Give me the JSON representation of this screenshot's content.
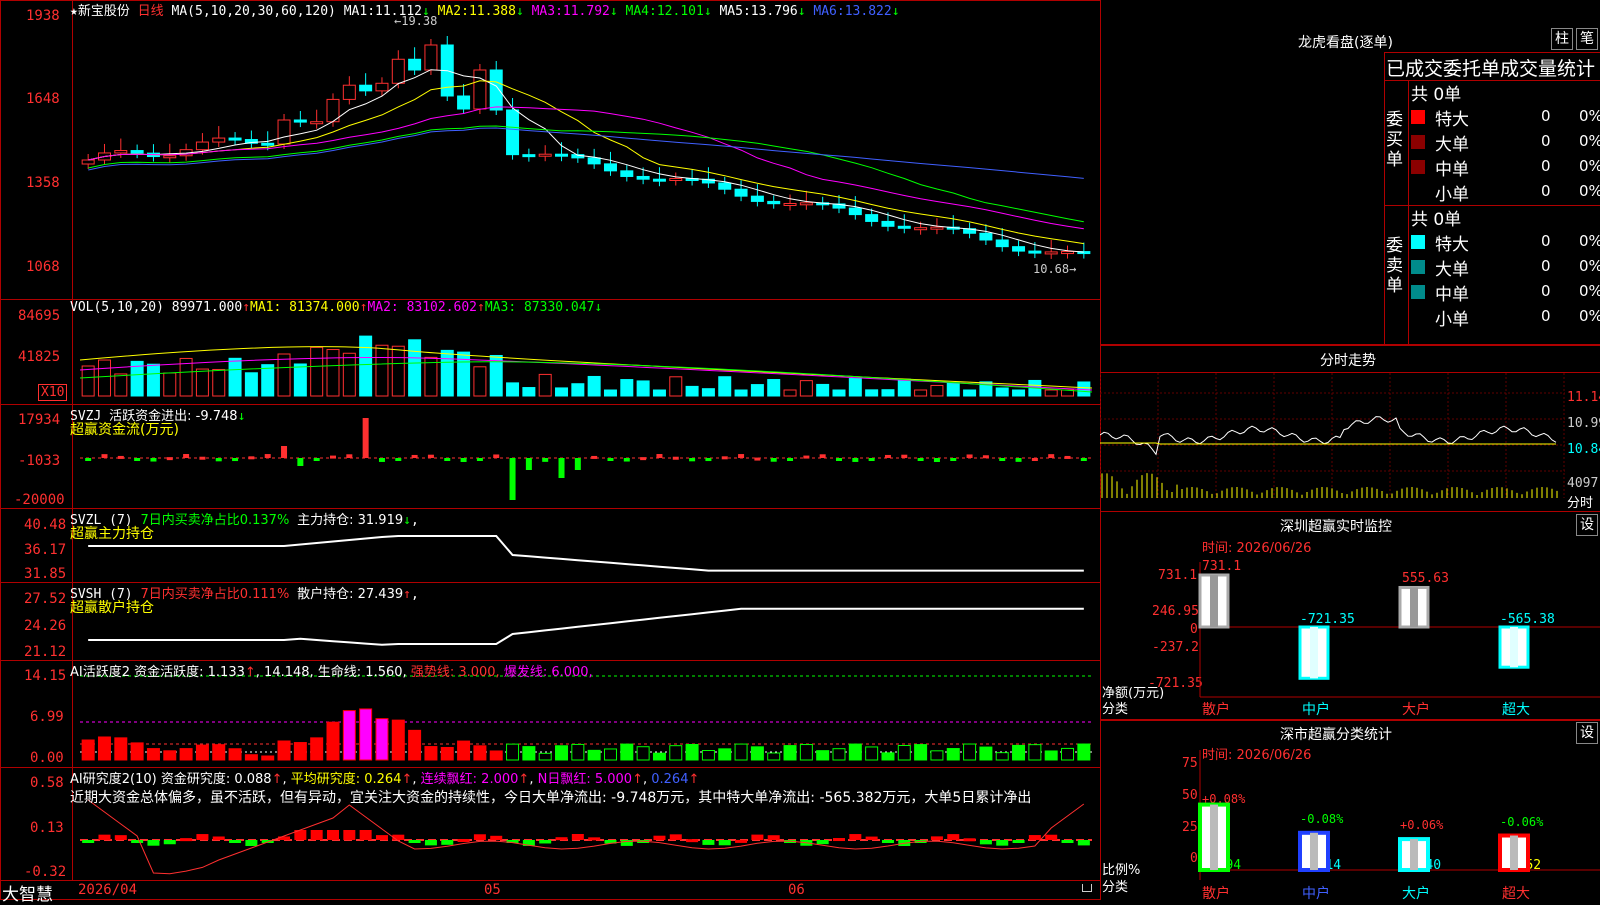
{
  "stock": {
    "star": "★",
    "name": "新宝股份",
    "period": "日线",
    "ma_label": "MA(5,10,20,30,60,120)",
    "ma": [
      {
        "name": "MA1:",
        "value": "11.112",
        "arrow": "↓"
      },
      {
        "name": "MA2:",
        "value": "11.388",
        "arrow": "↓"
      },
      {
        "name": "MA3:",
        "value": "11.792",
        "arrow": "↓"
      },
      {
        "name": "MA4:",
        "value": "12.101",
        "arrow": "↓"
      },
      {
        "name": "MA5:",
        "value": "13.796",
        "arrow": "↓"
      },
      {
        "name": "MA6:",
        "value": "13.822",
        "arrow": "↓"
      }
    ],
    "high_marker": "19.38",
    "low_marker": "10.68"
  },
  "price_axis": [
    "1938",
    "1648",
    "1358",
    "1068"
  ],
  "vol": {
    "label": "VOL(5,10,20)",
    "value": "89971.000",
    "arrow": "↑",
    "ma1": "MA1: 81374.000",
    "ma1_arrow": "↑",
    "ma2": "MA2: 83102.602",
    "ma2_arrow": "↑",
    "ma3": "MA3: 87330.047",
    "ma3_arrow": "↓",
    "axis": [
      "84695",
      "41825"
    ],
    "unit": "X10"
  },
  "svzj": {
    "label": "SVZJ",
    "text": "活跃资金进出: -9.748",
    "arrow": "↓",
    "subtitle": "超赢资金流(万元)",
    "axis": [
      "17934",
      "-1033",
      "-20000"
    ]
  },
  "svzl": {
    "label": "SVZL (7)",
    "ratio": "7日内买卖净占比0.137%",
    "hold": "主力持仓: 31.919",
    "arrow": "↓",
    "tail": ",",
    "subtitle": "超赢主力持仓",
    "axis": [
      "40.48",
      "36.17",
      "31.85"
    ]
  },
  "svsh": {
    "label": "SVSH (7)",
    "ratio": "7日内买卖净占比0.111%",
    "hold": "散户持仓: 27.439",
    "arrow": "↑",
    "tail": ",",
    "subtitle": "超赢散户持仓",
    "axis": [
      "27.52",
      "24.26",
      "21.12"
    ]
  },
  "ai_active": {
    "label": "AI活跃度2",
    "text1": "资金活跃度: 1.133",
    "arrow1": "↑",
    "text2": ", 14.148, 生命线: 1.560,",
    "strong": "强势线: 3.000,",
    "burst": "爆发线: 6.000,",
    "axis": [
      "14.15",
      "6.99",
      "0.00"
    ]
  },
  "ai_research": {
    "label": "AI研究度2(10)",
    "text1": "资金研究度: 0.088",
    "arrow1": "↑",
    "avg": "平均研究度: 0.264",
    "arrow2": "↑",
    "red_cnt": "连续飘红: 2.000",
    "arrow3": "↑",
    "n_red": "N日飘红: 5.000",
    "arrow4": "↑",
    "last": "0.264",
    "arrow5": "↑",
    "commentary": "近期大资金总体偏多，虽不活跃，但有异动，宜关注大资金的持续性，今日大单净流出: -9.748万元，其中特大单净流出: -565.382万元，大单5日累计净出",
    "axis": [
      "0.58",
      "0.13",
      "-0.32"
    ]
  },
  "bottom": {
    "brand": "大智慧",
    "date_start": "2026/04",
    "month1": "05",
    "month2": "06"
  },
  "lhb": {
    "title": "龙虎看盘(逐单)",
    "btn1": "柱",
    "btn2": "笔",
    "subtitle": "已成交委托单成交量统计",
    "buy_side": "委买单",
    "sell_side": "委卖单",
    "buy_total": "共 0单",
    "sell_total": "共 0单",
    "rows": [
      "特大",
      "大单",
      "中单",
      "小单"
    ],
    "count": "0",
    "pct": "0%",
    "colors_buy": [
      "#ff0000",
      "#8b0000",
      "#8b0000"
    ],
    "colors_sell": [
      "#00ffff",
      "#008b8b",
      "#008b8b"
    ]
  },
  "intraday": {
    "title": "分时走势",
    "axis": [
      "11.14",
      "10.99",
      "10.84"
    ],
    "vol": "4097",
    "vol_unit": "分时"
  },
  "sz_monitor": {
    "title": "深圳超赢实时监控",
    "btn": "设",
    "date": "时间: 2026/06/26",
    "axis": [
      "731.1",
      "246.95",
      "0",
      "-237.2",
      "-721.35"
    ],
    "ylabel": "净额(万元)",
    "xlabel": "分类",
    "bars": [
      {
        "name": "散户",
        "value": "731.1"
      },
      {
        "name": "中户",
        "value": "-721.35"
      },
      {
        "name": "大户",
        "value": "555.63"
      },
      {
        "name": "超大",
        "value": "-565.38"
      }
    ]
  },
  "sz_class": {
    "title": "深市超赢分类统计",
    "btn": "设",
    "date": "时间: 2026/06/26",
    "axis": [
      "75",
      "50",
      "25",
      "0"
    ],
    "ylabel": "比例%",
    "xlabel": "分类",
    "bars": [
      {
        "name": "散户",
        "value": "38.94",
        "delta": "+0.08%"
      },
      {
        "name": "中户",
        "value": "22.14",
        "delta": "-0.08%"
      },
      {
        "name": "大户",
        "value": "18.40",
        "delta": "+0.06%"
      },
      {
        "name": "超大",
        "value": "20.52",
        "delta": "-0.06%"
      }
    ]
  }
}
